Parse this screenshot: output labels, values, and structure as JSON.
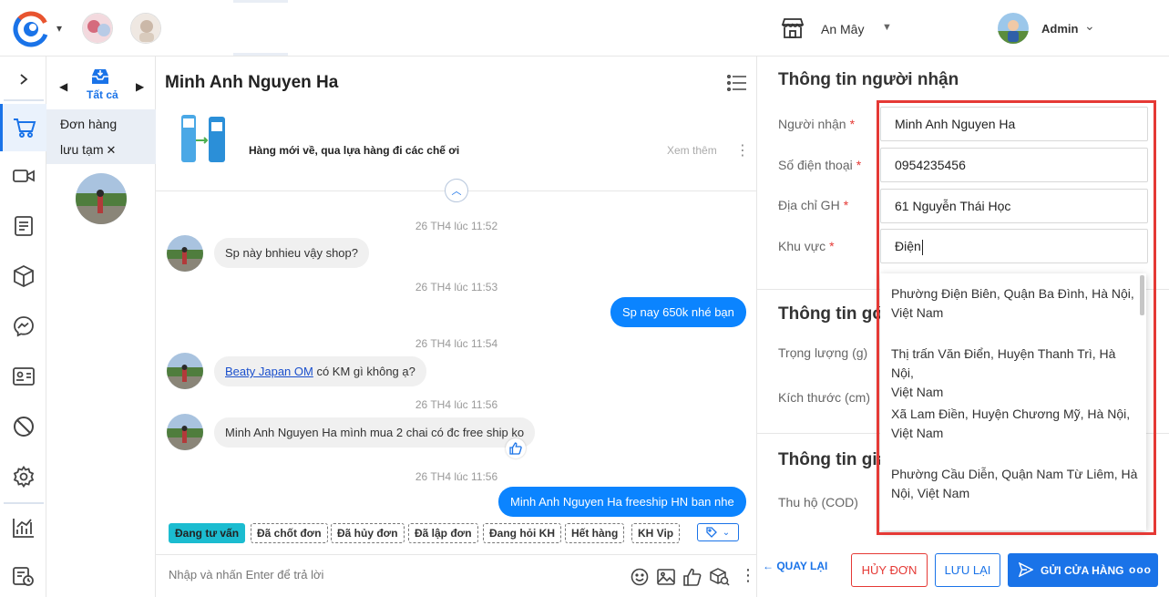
{
  "header": {
    "store_name": "An Mây",
    "user_name": "Admin"
  },
  "sidebar": {
    "items": [
      {
        "icon": "expand-chevron-icon"
      },
      {
        "icon": "cart-icon",
        "active": true
      },
      {
        "icon": "video-icon"
      },
      {
        "icon": "notes-icon"
      },
      {
        "icon": "box-icon"
      },
      {
        "icon": "messenger-icon"
      },
      {
        "icon": "id-card-icon"
      },
      {
        "icon": "block-icon"
      },
      {
        "icon": "settings-icon"
      },
      {
        "icon": "analytics-icon"
      },
      {
        "icon": "history-icon"
      }
    ]
  },
  "conversations": {
    "tab_label": "Tất cả",
    "draft_line1": "Đơn hàng",
    "draft_line2": "lưu tạm",
    "draft_close": "✕"
  },
  "chat": {
    "title": "Minh Anh Nguyen Ha",
    "product_text": "Hàng mới về, qua lựa hàng đi các chế ơi",
    "product_more": "Xem thêm",
    "messages": [
      {
        "time": "26 TH4 lúc 11:52",
        "direction": "in",
        "text": "Sp này bnhieu vậy shop?"
      },
      {
        "time": "26 TH4 lúc 11:53",
        "direction": "out",
        "text": "Sp nay 650k nhé bạn"
      },
      {
        "time": "26 TH4 lúc 11:54",
        "direction": "in",
        "link": "Beaty Japan OM",
        "text": "có KM gì không ạ?"
      },
      {
        "time": "26 TH4 lúc 11:56",
        "direction": "in",
        "text": "Minh Anh Nguyen Ha mình mua 2 chai có đc free ship ko"
      },
      {
        "time": "26 TH4 lúc 11:56",
        "direction": "out",
        "text": "Minh Anh Nguyen Ha freeship HN ban nhe"
      }
    ],
    "tags": [
      "Đang tư vấn",
      "Đã chốt đơn",
      "Đã hủy đơn",
      "Đã lập đơn",
      "Đang hỏi KH",
      "Hết hàng",
      "KH Vip"
    ],
    "compose_placeholder": "Nhập và nhấn Enter để trả lời"
  },
  "order_form": {
    "recipient_section": "Thông tin người nhận",
    "recipient_label": "Người nhận",
    "recipient_value": "Minh Anh Nguyen Ha",
    "phone_label": "Số điện thoại",
    "phone_value": "0954235456",
    "address_label": "Địa chỉ GH",
    "address_value": "61 Nguyễn Thái Học",
    "area_label": "Khu vực",
    "area_value": "Điện",
    "required_mark": "*",
    "shipping_section": "Thông tin gó",
    "weight_label": "Trọng lượng (g)",
    "size_label": "Kích thước (cm)",
    "payment_section": "Thông tin gia",
    "cod_label": "Thu hộ (COD)",
    "area_suggestions": [
      {
        "line1": "Phường Điện Biên, Quận Ba Đình, Hà Nội,",
        "line2": "Việt Nam"
      },
      {
        "line1": "Thị trấn Văn Điển, Huyện Thanh Trì, Hà Nội,",
        "line2": "Việt Nam"
      },
      {
        "line1": "Xã Lam Điền, Huyện Chương Mỹ, Hà Nội,",
        "line2": "Việt Nam"
      },
      {
        "line1": "Phường Cầu Diễn, Quận Nam Từ Liêm, Hà",
        "line2": "Nội, Việt Nam"
      }
    ]
  },
  "footer": {
    "back_label": "QUAY LẠI",
    "cancel_label": "HỦY ĐƠN",
    "save_label": "LƯU LẠI",
    "send_label": "GỬI CỬA HÀNG",
    "more_label": "ooo"
  },
  "colors": {
    "accent": "#1a73e8",
    "outgoing_bubble": "#0b84ff",
    "danger": "#e53935",
    "active_tag": "#1bbcd0"
  }
}
